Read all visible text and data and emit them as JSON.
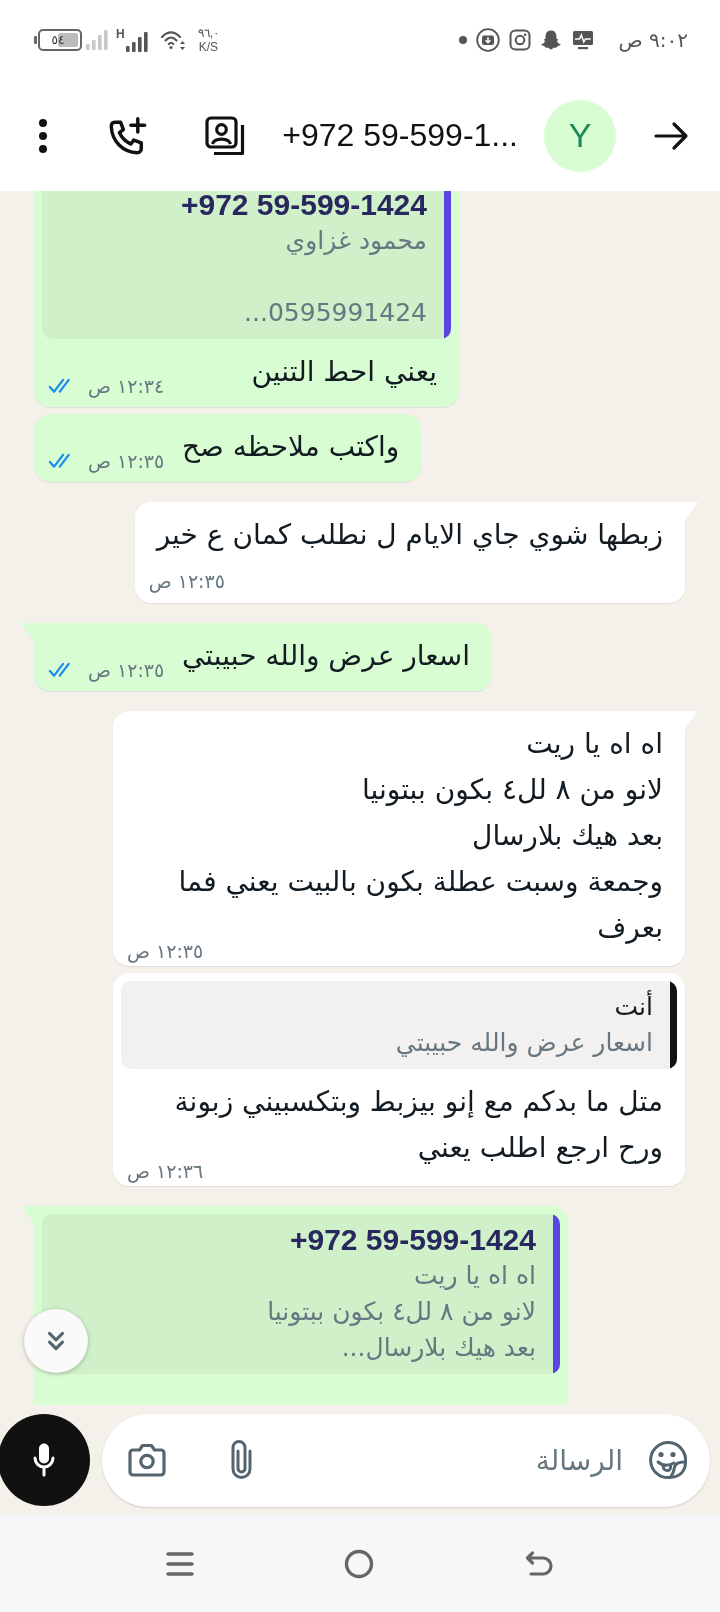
{
  "status_bar": {
    "battery": "٥٤",
    "network": "H",
    "speed": "٩٦,٠",
    "speed_unit": "K/S",
    "time": "٩:٠٢ ص"
  },
  "header": {
    "avatar": "Y",
    "title": "+972 59-599-1..."
  },
  "messages": [
    {
      "kind": "sent",
      "tail": false,
      "quote": {
        "author": "+972 59-599-1424",
        "from_self": false,
        "color": "#5b45e0",
        "text": "محمود غزاوي\n\n0595991424..."
      },
      "text": "يعني احط التنين",
      "time": "١٢:٣٤ ص",
      "read": true
    },
    {
      "kind": "sent",
      "tail": false,
      "text": "واكتب ملاحظه صح",
      "time": "١٢:٣٥ ص",
      "read": true
    },
    {
      "kind": "received",
      "tail": true,
      "text": "زبطها شوي جاي الايام ل نطلب كمان ع خير",
      "time": "١٢:٣٥ ص"
    },
    {
      "kind": "sent",
      "tail": true,
      "text": "اسعار عرض والله حبيبتي",
      "time": "١٢:٣٥ ص",
      "read": true
    },
    {
      "kind": "received",
      "tail": true,
      "text": "اه اه يا ريت\nلانو من ٨ لل٤ بكون ببتونيا\nبعد هيك بلارسال\nوجمعة وسبت عطلة بكون بالبيت يعني فما بعرف",
      "time": "١٢:٣٥ ص"
    },
    {
      "kind": "received",
      "tail": false,
      "quote": {
        "author": "أنت",
        "from_self": true,
        "color": "#111111",
        "text": "اسعار عرض والله حبيبتي"
      },
      "text": "متل ما بدكم مع إنو بيزبط وبتكسبيني زبونة ورح ارجع اطلب يعني",
      "time": "١٢:٣٦ ص"
    },
    {
      "kind": "sent",
      "tail": true,
      "quote": {
        "author": "+972 59-599-1424",
        "from_self": false,
        "color": "#5b45e0",
        "text": "اه اه يا ريت\nلانو من ٨ لل٤ بكون ببتونيا\nبعد هيك بلارسال..."
      }
    }
  ],
  "composer": {
    "placeholder": "الرسالة"
  }
}
